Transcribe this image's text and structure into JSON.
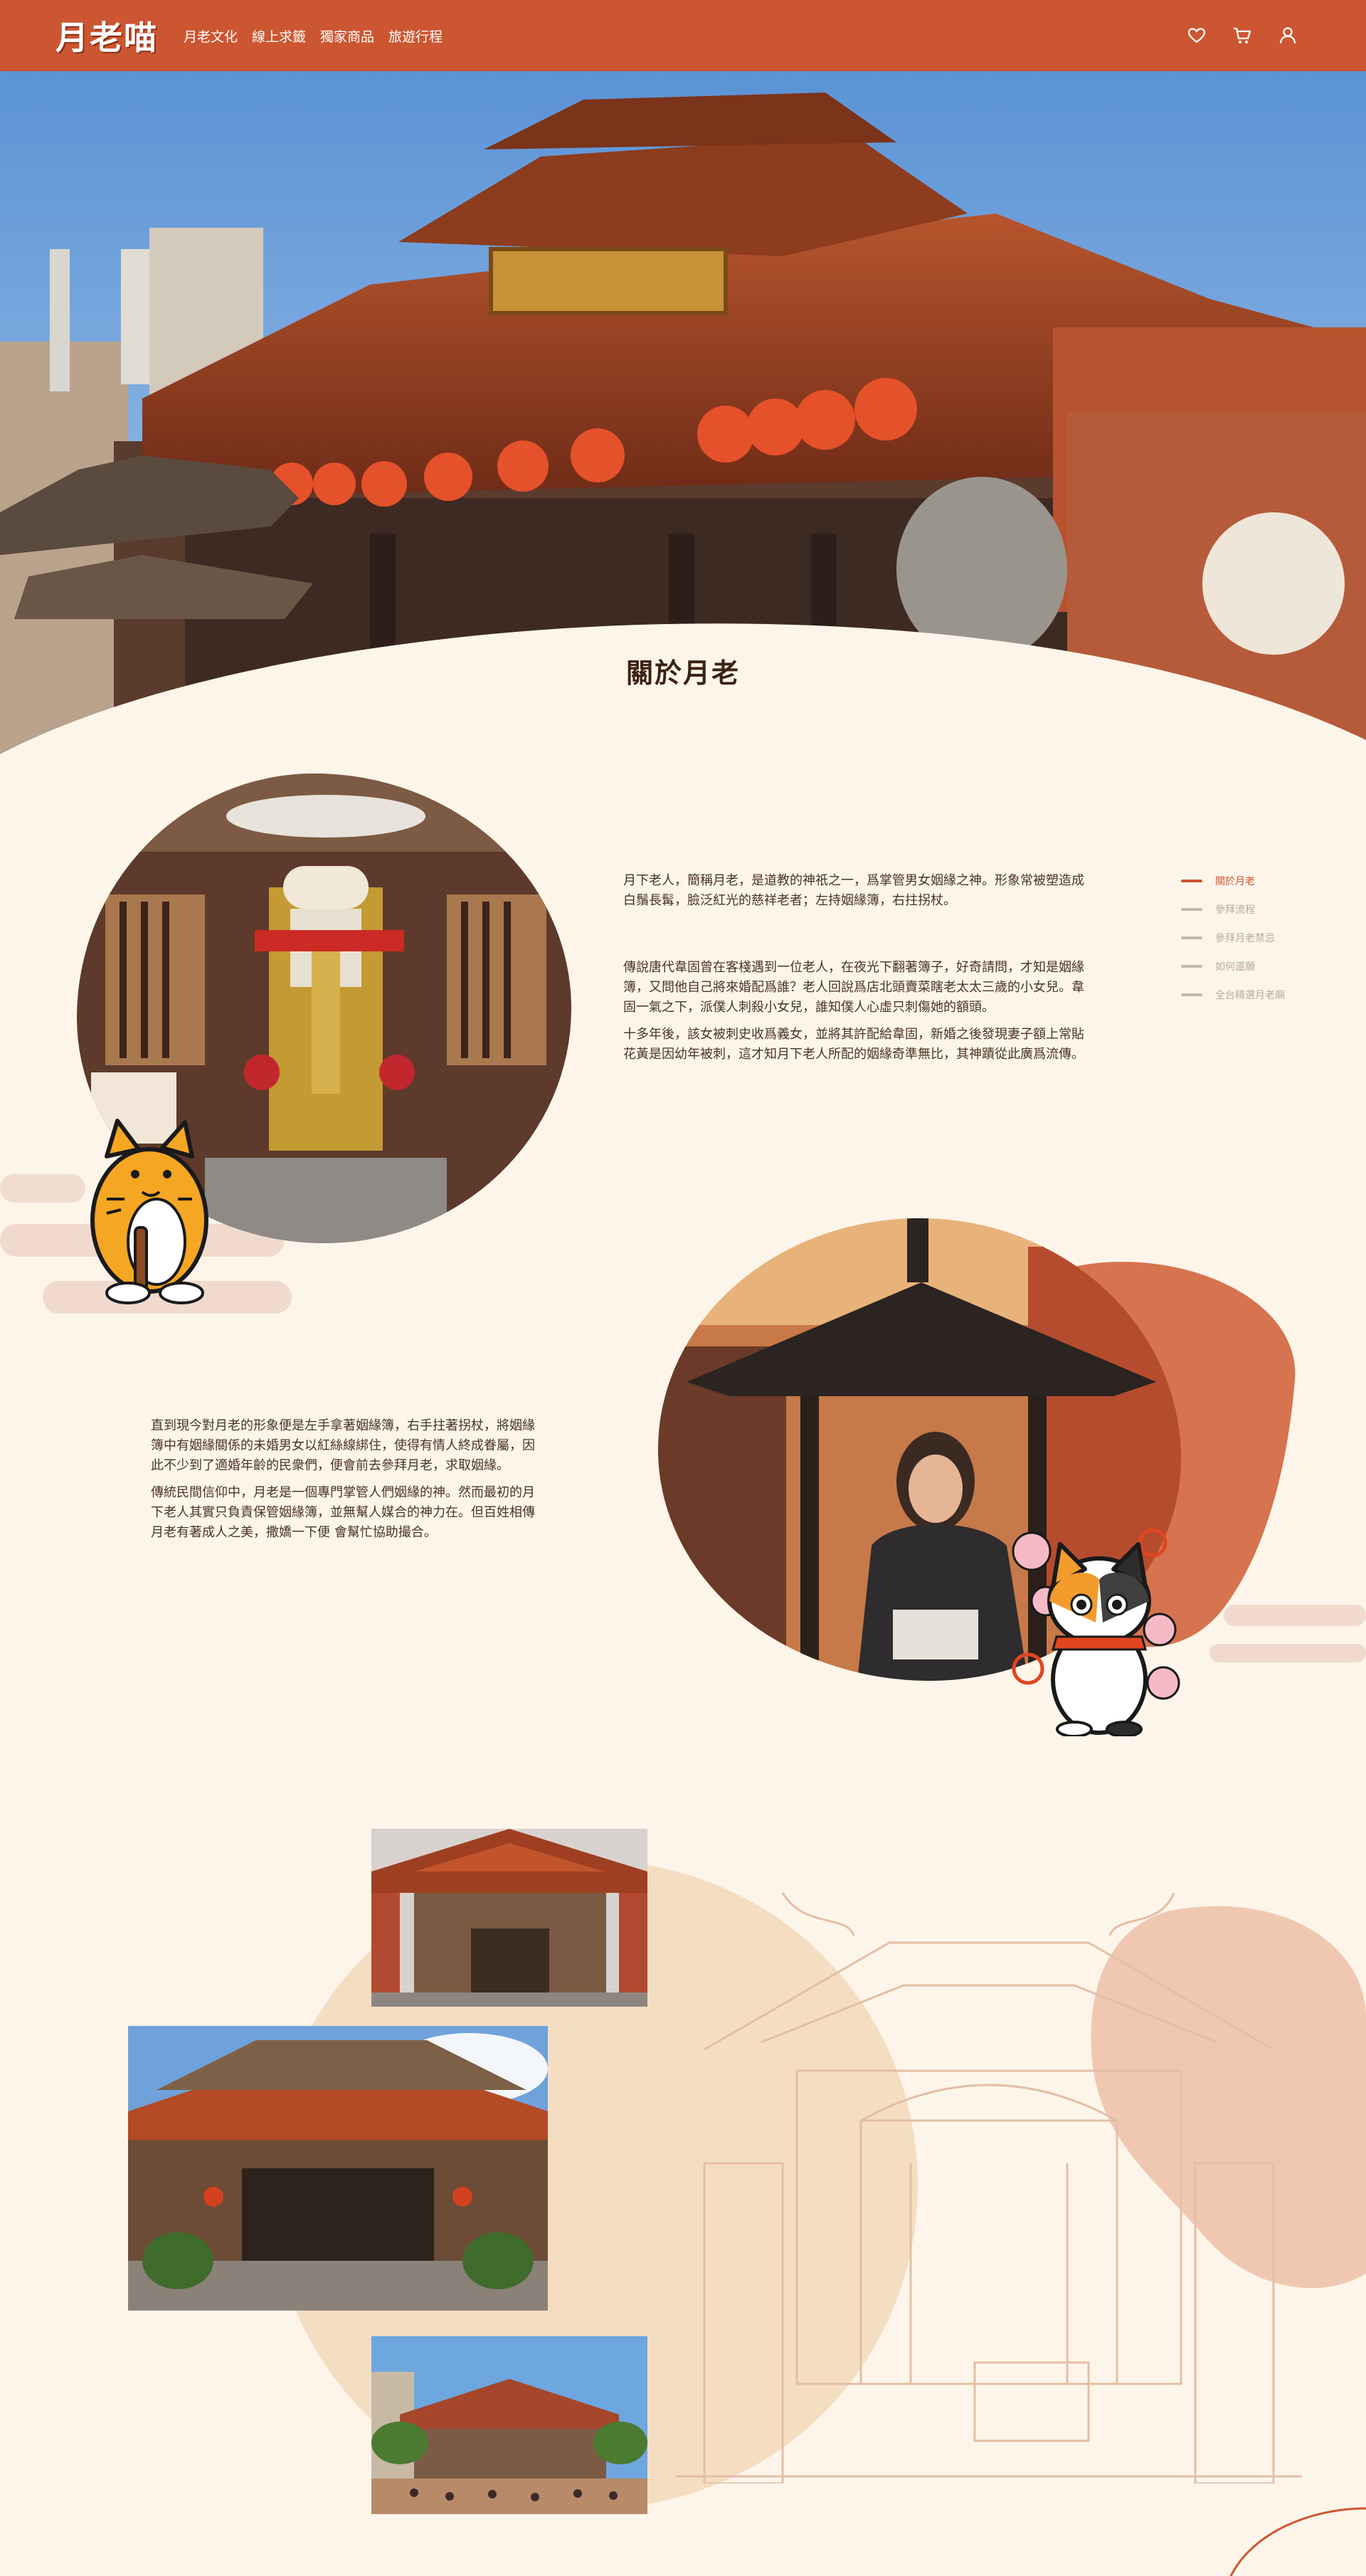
{
  "brand": {
    "logo": "月老喵",
    "accent": "#cc5631",
    "background": "#fdf5ea"
  },
  "nav": {
    "links": [
      "月老文化",
      "線上求籤",
      "獨家商品",
      "旅遊行程"
    ],
    "icons": [
      "heart-icon",
      "cart-icon",
      "user-icon"
    ]
  },
  "about": {
    "title": "關於月老",
    "para1": "月下老人，簡稱月老，是道教的神祇之一，爲掌管男女姻緣之神。形象常被塑造成白鬚長髯，臉泛紅光的慈祥老者；左持姻緣簿，右拄拐杖。",
    "para2": "傳說唐代韋固曾在客棧遇到一位老人，在夜光下翻著簿子，好奇請問，才知是姻緣簿，又問他自己將來婚配爲誰？老人回說爲店北頭賣菜瞎老太太三歲的小女兒。韋固一氣之下，派僕人刺殺小女兒，誰知僕人心虛只刺傷她的額頭。",
    "para3": "十多年後，該女被刺史收爲義女，並將其許配給韋固，新婚之後發現妻子額上常貼花黃是因幼年被刺，這才知月下老人所配的姻緣奇準無比，其神蹟從此廣爲流傳。",
    "para4": "直到現今對月老的形象便是左手拿著姻緣簿，右手拄著拐杖，將姻緣簿中有姻緣關係的未婚男女以紅絲線綁住，使得有情人終成眷屬，因此不少到了適婚年齡的民衆們，便會前去參拜月老，求取姻緣。",
    "para5": "傳統民間信仰中，月老是一個專門掌管人們姻緣的神。然而最初的月下老人其實只負責保管姻緣簿，並無幫人媒合的神力在。但百姓相傳月老有著成人之美，撒嬌一下便 會幫忙協助撮合。"
  },
  "side_nav": {
    "items": [
      "關於月老",
      "參拜流程",
      "參拜月老禁忌",
      "如何還願",
      "全台精選月老廟"
    ],
    "active": "關於月老"
  }
}
